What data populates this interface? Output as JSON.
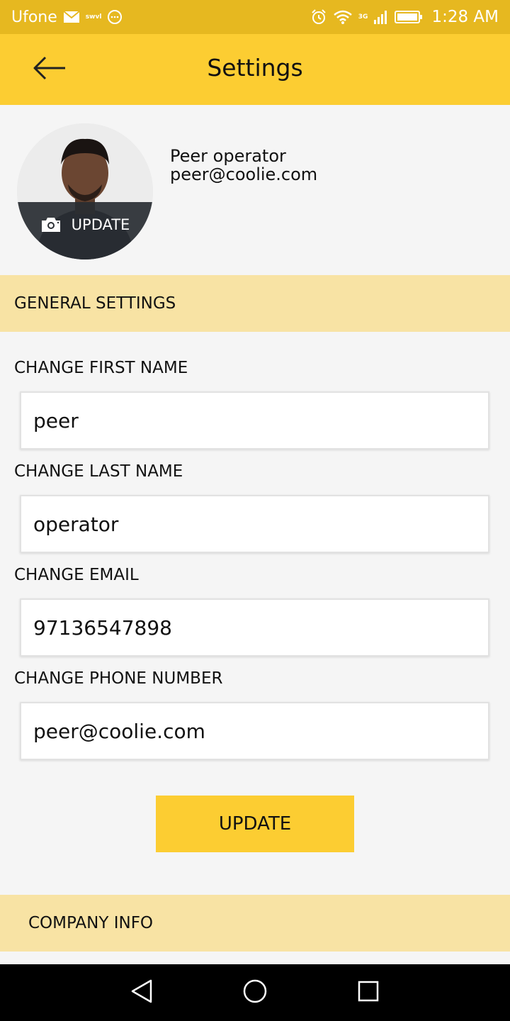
{
  "status_bar": {
    "carrier": "Ufone",
    "mini_text": "swvl",
    "network": "3G",
    "time": "1:28 AM",
    "icons": [
      "mail-icon",
      "swvl-icon",
      "chat-icon",
      "alarm-icon",
      "wifi-icon",
      "signal-icon",
      "battery-icon"
    ]
  },
  "app_bar": {
    "title": "Settings",
    "back_icon": "back-arrow-icon"
  },
  "profile": {
    "name": "Peer operator",
    "email": "peer@coolie.com",
    "avatar_action": "UPDATE",
    "camera_icon": "camera-icon"
  },
  "general_settings": {
    "header": "GENERAL SETTINGS",
    "fields": [
      {
        "label": "CHANGE FIRST NAME",
        "value": "peer"
      },
      {
        "label": "CHANGE LAST NAME",
        "value": "operator"
      },
      {
        "label": "CHANGE EMAIL",
        "value": "97136547898"
      },
      {
        "label": "CHANGE PHONE NUMBER",
        "value": "peer@coolie.com"
      }
    ],
    "update_button": "UPDATE"
  },
  "company_info": {
    "header": "COMPANY INFO"
  },
  "colors": {
    "status_bar": "#e6b820",
    "app_bar": "#fccd32",
    "section_header": "#f8e3a4",
    "background": "#f5f5f5",
    "nav_bar": "#000000"
  },
  "nav_bar": {
    "icons": [
      "nav-back-icon",
      "nav-home-icon",
      "nav-recents-icon"
    ]
  }
}
